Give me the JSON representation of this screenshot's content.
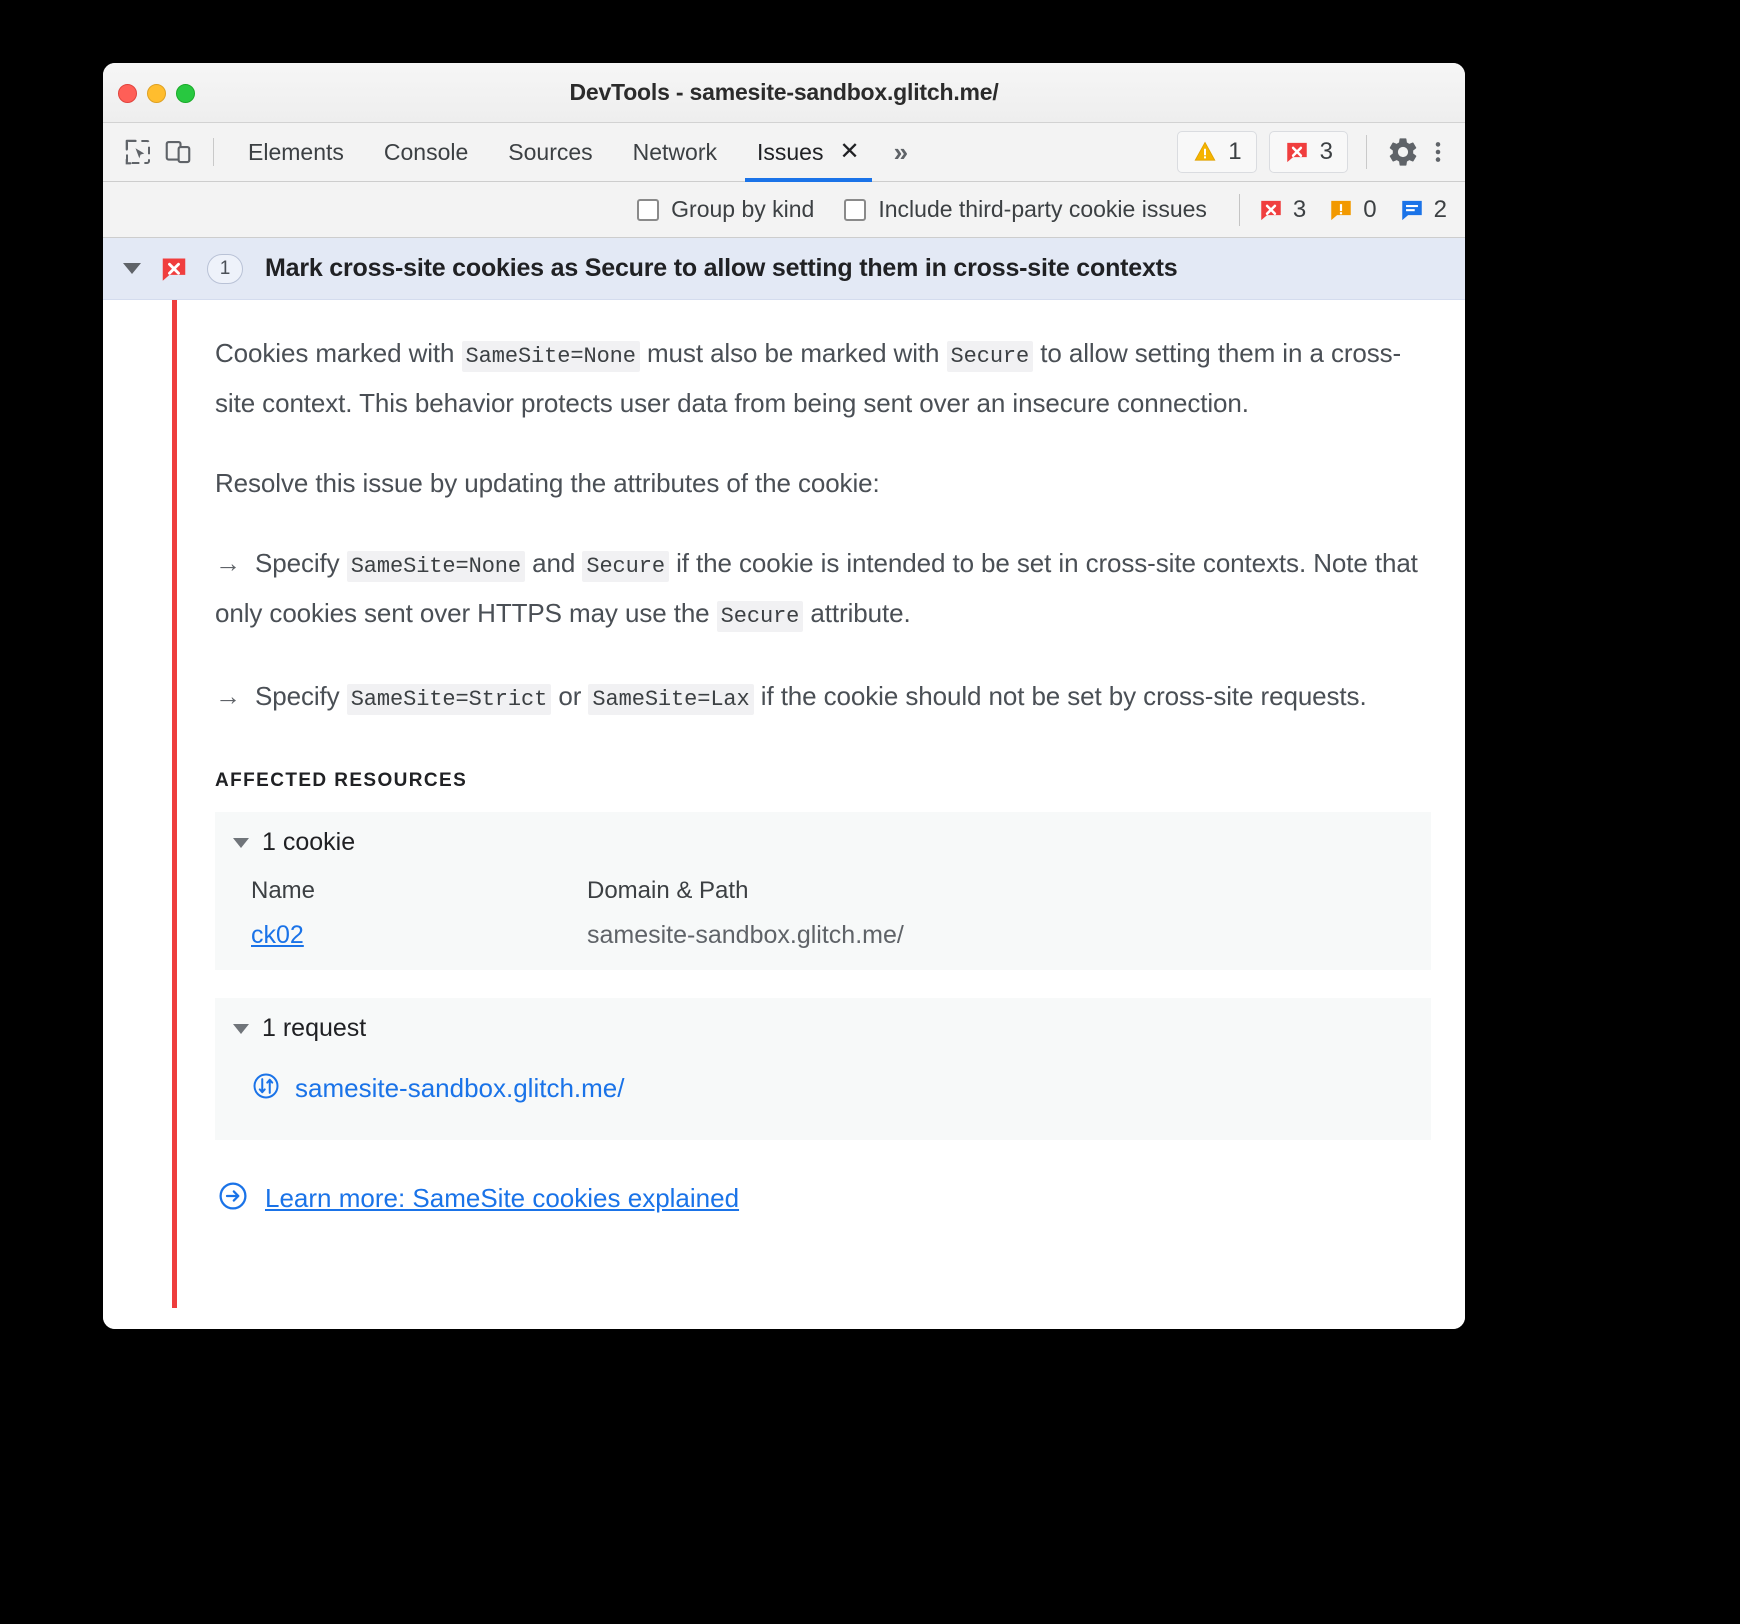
{
  "window": {
    "title": "DevTools - samesite-sandbox.glitch.me/",
    "traffic_lights": [
      "close",
      "minimize",
      "maximize"
    ],
    "colors": {
      "close": "#ff5f57",
      "minimize": "#ffbd2e",
      "maximize": "#28c840",
      "accent": "#1a73e8",
      "error_red": "#ee3d3d",
      "warning_orange": "#f29900",
      "issue_header_bg": "#e3e9f5"
    }
  },
  "toolbar": {
    "icons": [
      {
        "name": "inspect-element-icon"
      },
      {
        "name": "device-toolbar-icon"
      }
    ],
    "tabs": [
      {
        "label": "Elements",
        "active": false
      },
      {
        "label": "Console",
        "active": false
      },
      {
        "label": "Sources",
        "active": false
      },
      {
        "label": "Network",
        "active": false
      },
      {
        "label": "Issues",
        "active": true,
        "closable": true
      }
    ],
    "tab_close_glyph": "✕",
    "more_tabs_glyph": "»",
    "counters": [
      {
        "icon": "warning-triangle-icon",
        "value": "1"
      },
      {
        "icon": "error-badge-icon",
        "value": "3"
      }
    ],
    "settings_icon": "gear-icon",
    "menu_icon": "kebab-menu-icon"
  },
  "filter_bar": {
    "checkboxes": [
      {
        "label": "Group by kind",
        "checked": false
      },
      {
        "label": "Include third-party cookie issues",
        "checked": false
      }
    ],
    "counts": [
      {
        "icon": "error-badge-icon",
        "value": "3"
      },
      {
        "icon": "warning-badge-icon",
        "value": "0"
      },
      {
        "icon": "info-bubble-icon",
        "value": "2"
      }
    ]
  },
  "issue": {
    "expanded": true,
    "kind_icon": "error-badge-icon",
    "count_badge": "1",
    "title": "Mark cross-site cookies as Secure to allow setting them in cross-site contexts",
    "paragraphs": [
      {
        "parts": [
          {
            "t": "text",
            "v": "Cookies marked with "
          },
          {
            "t": "code",
            "v": "SameSite=None"
          },
          {
            "t": "text",
            "v": " must also be marked with "
          },
          {
            "t": "code",
            "v": "Secure"
          },
          {
            "t": "text",
            "v": " to allow setting them in a cross-site context. This behavior protects user data from being sent over an insecure connection."
          }
        ]
      },
      {
        "parts": [
          {
            "t": "text",
            "v": "Resolve this issue by updating the attributes of the cookie:"
          }
        ]
      },
      {
        "parts": [
          {
            "t": "arrow",
            "v": "→"
          },
          {
            "t": "text",
            "v": "Specify "
          },
          {
            "t": "code",
            "v": "SameSite=None"
          },
          {
            "t": "text",
            "v": " and "
          },
          {
            "t": "code",
            "v": "Secure"
          },
          {
            "t": "text",
            "v": " if the cookie is intended to be set in cross-site contexts. Note that only cookies sent over HTTPS may use the "
          },
          {
            "t": "code",
            "v": "Secure"
          },
          {
            "t": "text",
            "v": " attribute."
          }
        ]
      },
      {
        "parts": [
          {
            "t": "arrow",
            "v": "→"
          },
          {
            "t": "text",
            "v": "Specify "
          },
          {
            "t": "code",
            "v": "SameSite=Strict"
          },
          {
            "t": "text",
            "v": " or "
          },
          {
            "t": "code",
            "v": "SameSite=Lax"
          },
          {
            "t": "text",
            "v": " if the cookie should not be set by cross-site requests."
          }
        ]
      }
    ],
    "affected_resources_label": "AFFECTED RESOURCES",
    "cookies_section": {
      "header": "1 cookie",
      "expanded": true,
      "columns": [
        "Name",
        "Domain & Path"
      ],
      "rows": [
        {
          "name": "ck02",
          "domain_path": "samesite-sandbox.glitch.me/"
        }
      ]
    },
    "requests_section": {
      "header": "1 request",
      "expanded": true,
      "rows": [
        {
          "icon": "network-request-icon",
          "url": "samesite-sandbox.glitch.me/"
        }
      ]
    },
    "learn_more": {
      "icon": "circle-arrow-right-icon",
      "label": "Learn more: SameSite cookies explained"
    }
  }
}
